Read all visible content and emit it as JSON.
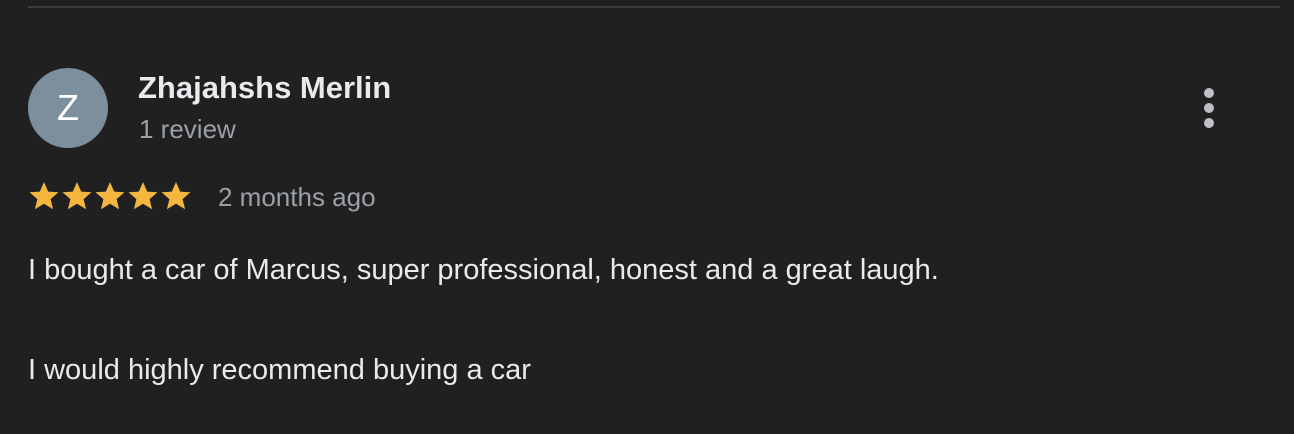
{
  "review": {
    "avatar_initial": "Z",
    "avatar_color": "#7b8f9c",
    "reviewer_name": "Zhajahshs Merlin",
    "review_count": "1 review",
    "rating": 5,
    "rating_max": 5,
    "star_color": "#f4b63f",
    "time_ago": "2 months ago",
    "text_lines": [
      "I bought a car of Marcus, super professional, honest and a great laugh.",
      "I would highly recommend buying a car"
    ],
    "more_icon": "more-vertical-icon"
  }
}
